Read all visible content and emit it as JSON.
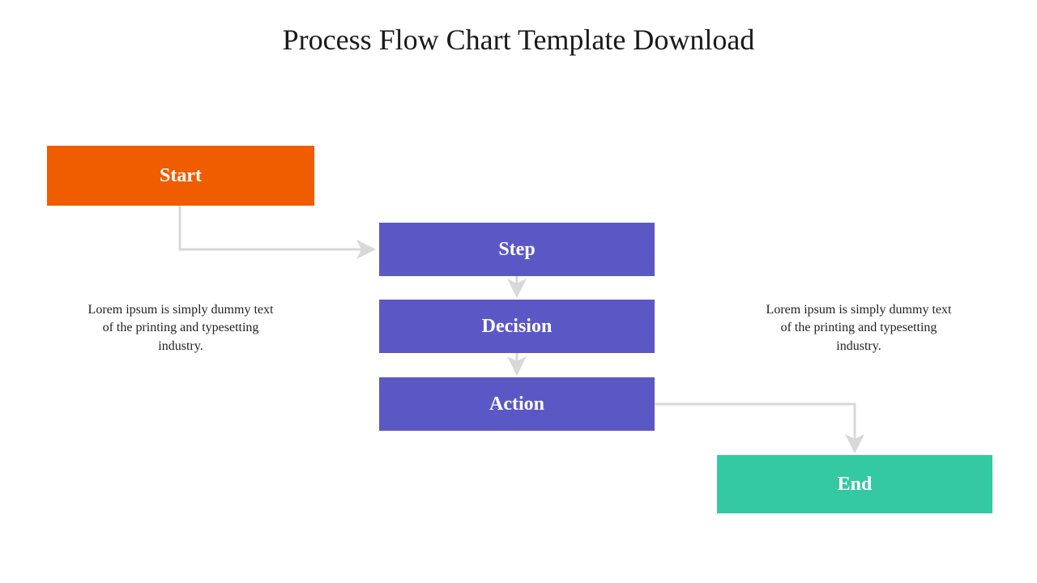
{
  "title": "Process Flow Chart Template Download",
  "nodes": {
    "start": "Start",
    "step": "Step",
    "decision": "Decision",
    "action": "Action",
    "end": "End"
  },
  "descriptions": {
    "left": "Lorem ipsum is simply dummy text of the printing and typesetting industry.",
    "right": "Lorem ipsum is simply dummy text of the printing and typesetting industry."
  },
  "colors": {
    "start": "#f05c00",
    "middle": "#5b58c6",
    "end": "#34c9a2",
    "connector": "#d8d8d8"
  }
}
